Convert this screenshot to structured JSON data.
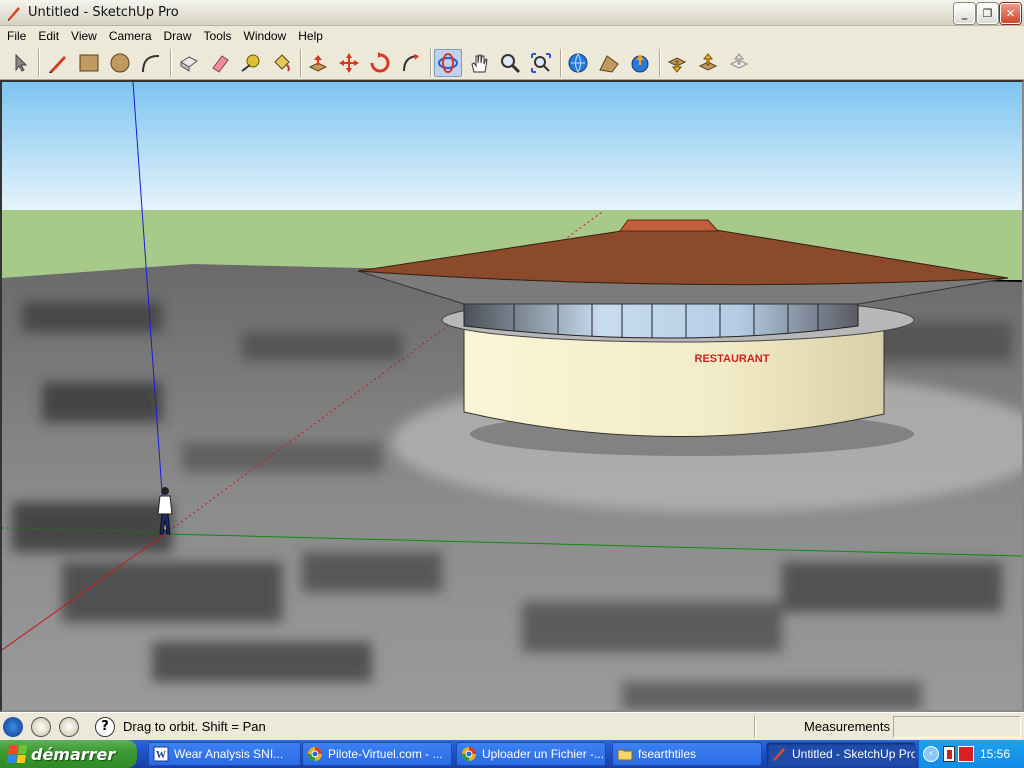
{
  "window": {
    "title": "Untitled - SketchUp Pro",
    "minimize_label": "_",
    "maximize_label": "❐",
    "close_label": "✕"
  },
  "menu": {
    "items": [
      "File",
      "Edit",
      "View",
      "Camera",
      "Draw",
      "Tools",
      "Window",
      "Help"
    ]
  },
  "toolbar": {
    "tools": [
      "select-tool",
      "pencil-tool",
      "rectangle-tool",
      "circle-tool",
      "arc-tool",
      "make-component-tool",
      "eraser-tool",
      "tape-measure-tool",
      "paint-bucket-tool",
      "push-pull-tool",
      "move-tool",
      "rotate-tool",
      "follow-me-tool",
      "orbit-tool",
      "pan-tool",
      "zoom-tool",
      "zoom-extents-tool",
      "get-current-view-tool",
      "toggle-terrain-tool",
      "place-model-tool",
      "get-models-tool",
      "share-model-tool",
      "share-component-tool"
    ],
    "active_tool": "orbit-tool"
  },
  "viewport": {
    "sign_text": "RESTAURANT",
    "colors": {
      "sky_top": "#7cc4f0",
      "sky_bottom": "#e8f4fb",
      "grass": "#a7c98a",
      "roof": "#8b4a2a",
      "wall": "#f3ecc8",
      "sign": "#d21f1f",
      "axis_blue": "#1a1ad8",
      "axis_green": "#0c8a0c",
      "axis_red": "#c81818"
    }
  },
  "statusbar": {
    "hint": "Drag to orbit.  Shift = Pan",
    "measurements_label": "Measurements",
    "measurements_value": ""
  },
  "taskbar": {
    "start_label": "démarrer",
    "tasks": [
      {
        "label": "Wear  Analysis SNI...",
        "icon": "word-icon"
      },
      {
        "label": "Pilote-Virtuel.com - ...",
        "icon": "chrome-icon"
      },
      {
        "label": "Uploader un Fichier -...",
        "icon": "chrome-icon"
      },
      {
        "label": "fsearthtiles",
        "icon": "folder-icon"
      },
      {
        "label": "Untitled - SketchUp Pro",
        "icon": "sketchup-icon"
      }
    ],
    "active_task": 4,
    "clock": "15:56"
  }
}
